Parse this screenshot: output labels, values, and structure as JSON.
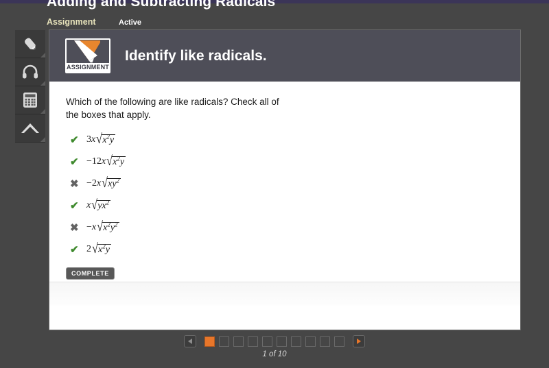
{
  "header": {
    "lesson_title": "Adding and Subtracting Radicals",
    "type_label": "Assignment",
    "status_label": "Active"
  },
  "sidebar": {
    "items": [
      {
        "icon": "pencil-icon",
        "name": "annotate-tool"
      },
      {
        "icon": "headphones-icon",
        "name": "audio-tool"
      },
      {
        "icon": "calculator-icon",
        "name": "calculator-tool"
      },
      {
        "icon": "chevron-up-icon",
        "name": "collapse-tool"
      }
    ]
  },
  "card": {
    "badge_label": "ASSIGNMENT",
    "title": "Identify like radicals.",
    "prompt": "Which of the following are like radicals? Check all of the boxes that apply.",
    "complete_label": "COMPLETE",
    "options": [
      {
        "mark": "check",
        "mark_glyph": "✔",
        "coefficient": "3x",
        "radicand": "x2y",
        "text": "3x√(x²y)"
      },
      {
        "mark": "check",
        "mark_glyph": "✔",
        "coefficient": "-12x",
        "radicand": "x2y",
        "text": "−12x√(x²y)"
      },
      {
        "mark": "cross",
        "mark_glyph": "✖",
        "coefficient": "-2x",
        "radicand": "xy2",
        "text": "−2x√(xy²)"
      },
      {
        "mark": "check",
        "mark_glyph": "✔",
        "coefficient": "x",
        "radicand": "yx2",
        "text": "x√(yx²)"
      },
      {
        "mark": "cross",
        "mark_glyph": "✖",
        "coefficient": "-x",
        "radicand": "x2y2",
        "text": "−x√(x²y²)"
      },
      {
        "mark": "check",
        "mark_glyph": "✔",
        "coefficient": "2",
        "radicand": "x2y",
        "text": "2√(x²y)"
      }
    ]
  },
  "pagination": {
    "prev_label": "◀",
    "next_label": "▶",
    "total_pages": 10,
    "current_page": 1,
    "counter_text": "1 of 10"
  },
  "colors": {
    "accent_orange": "#e8762a",
    "check_green": "#3f8a2e",
    "cross_gray": "#636363",
    "page_background": "#464646",
    "card_header": "#4e4e58",
    "top_strip_purple": "#3b3558",
    "meta_yellow": "#e7e3bb"
  }
}
